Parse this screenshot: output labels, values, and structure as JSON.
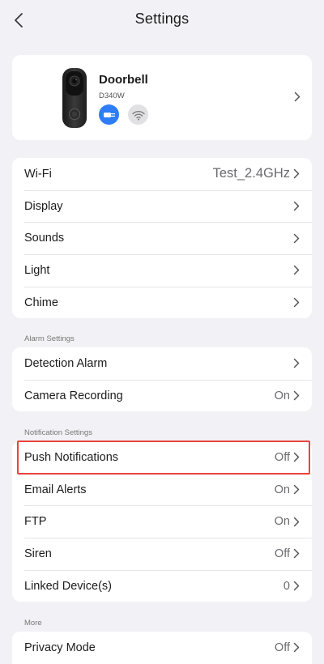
{
  "header": {
    "title": "Settings",
    "back_icon": "chevron-left-icon"
  },
  "device": {
    "name": "Doorbell",
    "model": "D340W",
    "power_icon": "power-plug-icon",
    "wifi_icon": "wifi-icon"
  },
  "general": {
    "items": [
      {
        "label": "Wi-Fi",
        "value": "Test_2.4GHz"
      },
      {
        "label": "Display",
        "value": ""
      },
      {
        "label": "Sounds",
        "value": ""
      },
      {
        "label": "Light",
        "value": ""
      },
      {
        "label": "Chime",
        "value": ""
      }
    ]
  },
  "alarm": {
    "section_label": "Alarm Settings",
    "items": [
      {
        "label": "Detection Alarm",
        "value": ""
      },
      {
        "label": "Camera Recording",
        "value": "On"
      }
    ]
  },
  "notification": {
    "section_label": "Notification Settings",
    "items": [
      {
        "label": "Push Notifications",
        "value": "Off"
      },
      {
        "label": "Email Alerts",
        "value": "On"
      },
      {
        "label": "FTP",
        "value": "On"
      },
      {
        "label": "Siren",
        "value": "Off"
      },
      {
        "label": "Linked Device(s)",
        "value": "0"
      }
    ]
  },
  "more": {
    "section_label": "More",
    "items": [
      {
        "label": "Privacy Mode",
        "value": "Off"
      }
    ]
  },
  "colors": {
    "accent": "#2e7cf6",
    "highlight": "#e8453c",
    "background": "#f2f2f6"
  }
}
